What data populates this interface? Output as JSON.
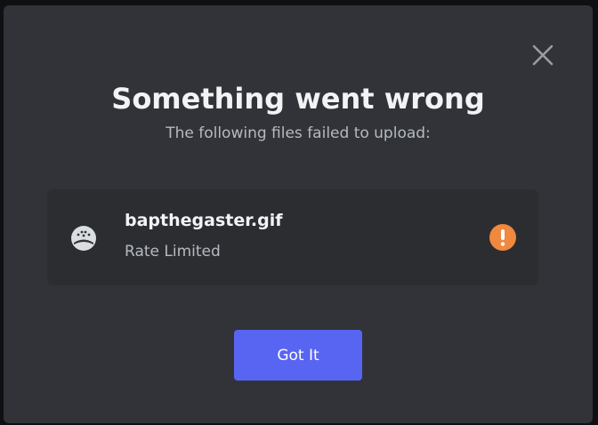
{
  "dialog": {
    "title": "Something went wrong",
    "subtitle": "The following files failed to upload:",
    "close_icon": "close-icon"
  },
  "failed_files": [
    {
      "name": "bapthegaster.gif",
      "status": "Rate Limited",
      "file_icon": "broken-file-face-icon",
      "status_icon": "warning-exclamation-icon"
    }
  ],
  "actions": {
    "confirm_label": "Got It"
  },
  "colors": {
    "modal_background": "#313338",
    "card_background": "#2b2d31",
    "primary_button": "#5865f2",
    "warning": "#f0883e",
    "title_text": "#f2f3f5",
    "muted_text": "#b5bac1"
  }
}
